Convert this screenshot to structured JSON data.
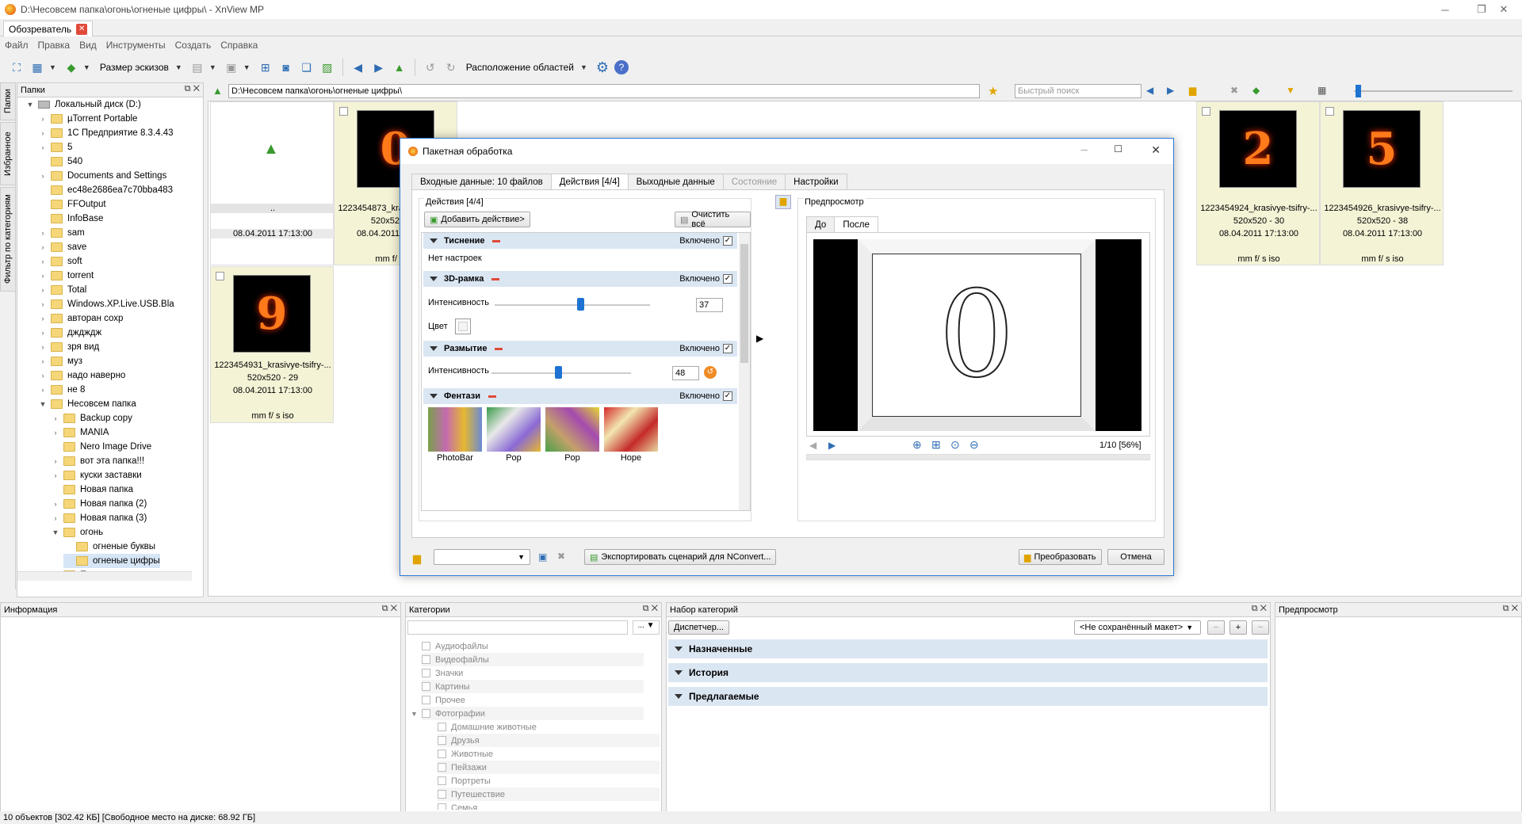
{
  "window": {
    "title": "D:\\Несовсем папка\\огонь\\огненые цифры\\ - XnView MP"
  },
  "tabs": [
    {
      "label": "Обозреватель"
    }
  ],
  "menu": [
    "Файл",
    "Правка",
    "Вид",
    "Инструменты",
    "Создать",
    "Справка"
  ],
  "toolbar": {
    "thumb_size": "Размер эскизов",
    "layout": "Расположение областей"
  },
  "side_tabs": [
    "Папки",
    "Избранное",
    "Фильтр по категориям"
  ],
  "folders": {
    "title": "Папки",
    "items": [
      "Локальный диск (D:)",
      "µTorrent Portable",
      "1С Предприятие 8.3.4.43",
      "5",
      "540",
      "Documents and Settings",
      "ec48e2686ea7c70bba483",
      "FFOutput",
      "InfoBase",
      "sam",
      "save",
      "soft",
      "torrent",
      "Total",
      "Windows.XP.Live.USB.Bla",
      "авторан сохр",
      "дждждж",
      "зря вид",
      "муз",
      "надо наверно",
      "не 8",
      "Несовсем папка",
      "Backup copy",
      "MANIA",
      "Nero Image Drive",
      "вот эта папка!!!",
      "куски заставки",
      "Новая папка",
      "Новая папка (2)",
      "Новая папка (3)",
      "огонь",
      "огненые буквы",
      "огненые цифры",
      "Папка с вариантами"
    ]
  },
  "pathbar": {
    "path": "D:\\Несовсем папка\\огонь\\огненые цифры\\",
    "quick_search_placeholder": "Быстрый поиск"
  },
  "thumbs": {
    "parent": {
      "name": "..",
      "date": "08.04.2011 17:13:00"
    },
    "items": [
      {
        "glyph": "0",
        "name": "1223454873_krasivye-tsifry-...",
        "size": "520x520 - 29",
        "date": "08.04.2011 17:13:00",
        "meta": "mm f/ s iso"
      },
      {
        "glyph": "2",
        "name": "1223454924_krasivye-tsifry-...",
        "size": "520x520 - 30",
        "date": "08.04.2011 17:13:00",
        "meta": "mm f/ s iso"
      },
      {
        "glyph": "5",
        "name": "1223454926_krasivye-tsifry-...",
        "size": "520x520 - 38",
        "date": "08.04.2011 17:13:00",
        "meta": "mm f/ s iso"
      },
      {
        "glyph": "9",
        "name": "1223454931_krasivye-tsifry-...",
        "size": "520x520 - 29",
        "date": "08.04.2011 17:13:00",
        "meta": "mm f/ s iso"
      }
    ]
  },
  "dialog": {
    "title": "Пакетная обработка",
    "tabs": [
      "Входные данные: 10 файлов",
      "Действия [4/4]",
      "Выходные данные",
      "Состояние",
      "Настройки"
    ],
    "actions_label": "Действия [4/4]",
    "add_action": "Добавить действие>",
    "clear_all": "Очистить всё",
    "enabled": "Включено",
    "actions": [
      {
        "name": "Тиснение",
        "note": "Нет настроек"
      },
      {
        "name": "3D-рамка",
        "intensity_label": "Интенсивность",
        "intensity": "37",
        "intensity_pct": 0.55,
        "color_label": "Цвет"
      },
      {
        "name": "Размытие",
        "intensity_label": "Интенсивность",
        "intensity": "48",
        "intensity_pct": 0.48
      },
      {
        "name": "Фентази",
        "presets": [
          "PhotoBar",
          "Pop",
          "Pop",
          "Hope"
        ]
      }
    ],
    "preview_label": "Предпросмотр",
    "preview_tabs": [
      "До",
      "После"
    ],
    "preview_counter": "1/10 [56%]",
    "export_label": "Экспортировать сценарий для NConvert...",
    "convert_label": "Преобразовать",
    "cancel_label": "Отмена"
  },
  "panels": {
    "info": "Информация",
    "categories": "Категории",
    "category_items": [
      "Аудиофайлы",
      "Видеофайлы",
      "Значки",
      "Картины",
      "Прочее",
      "Фотографии",
      "Домашние животные",
      "Друзья",
      "Животные",
      "Пейзажи",
      "Портреты",
      "Путешествие",
      "Семья"
    ],
    "category_sets": "Набор категорий",
    "dispatcher": "Диспетчер...",
    "layout_select": "<Не сохранённый макет>",
    "groups": [
      "Назначенные",
      "История",
      "Предлагаемые"
    ],
    "preview": "Предпросмотр"
  },
  "status": "10 объектов [302.42 КБ] [Свободное место на диске: 68.92 ГБ]"
}
